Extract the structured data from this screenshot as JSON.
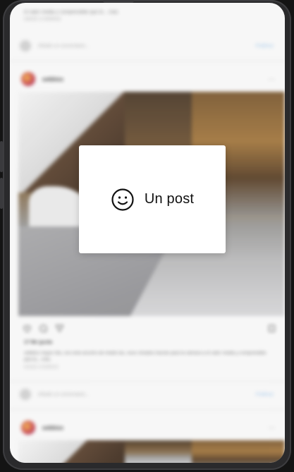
{
  "feed": {
    "top_caption": "el calor media y comprendido que le... más",
    "top_timestamp": "HACE 3 HORAS",
    "comment_placeholder": "Añade un comentario...",
    "comment_post_label": "Publicar",
    "posts": [
      {
        "username": "sebbiss",
        "more_label": "···",
        "likes": "17 Me gusta",
        "caption": "sebbiss mayor día, con este arcoíris de medio las, esos mirados hacían para la cámara a el calor media y comprendido que la... más",
        "timestamp": "HACE 3 HORAS"
      },
      {
        "username": "sebbiss",
        "more_label": "···"
      }
    ]
  },
  "modal": {
    "icon": "smiley-face-icon",
    "label": "Un post"
  },
  "colors": {
    "device_frame": "#2a2a2c",
    "screen_bg": "#f7f7f7",
    "modal_bg": "#ffffff",
    "publish_link": "#9bc5ea"
  }
}
